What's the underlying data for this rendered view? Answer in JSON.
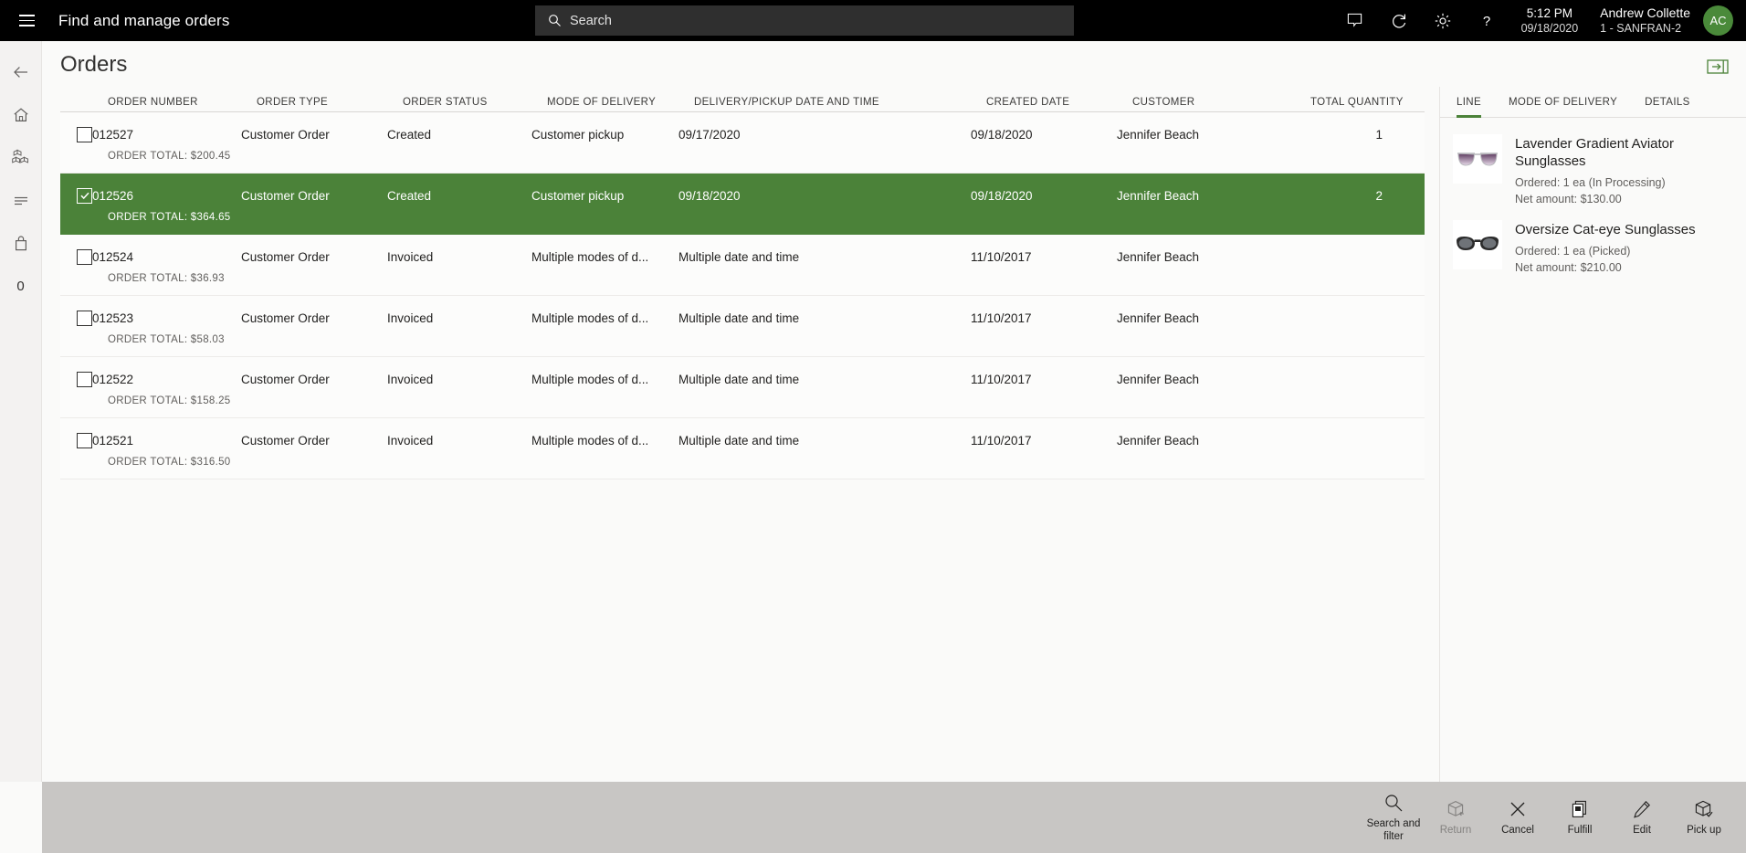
{
  "topbar": {
    "menu_icon": "hamburger-icon",
    "app_title": "Find and manage orders",
    "search": {
      "placeholder": "Search",
      "value": "",
      "icon": "search-icon"
    },
    "icons": [
      "comment-icon",
      "refresh-icon",
      "settings-gear-icon",
      "help-question-icon"
    ],
    "time": "5:12 PM",
    "date": "09/18/2020",
    "user_name": "Andrew Collette",
    "user_store": "1 - SANFRAN-2",
    "avatar_initials": "AC",
    "avatar_color": "#4a8a3a"
  },
  "rail": {
    "items": [
      {
        "name": "back-arrow-icon",
        "label": ""
      },
      {
        "name": "home-icon",
        "label": ""
      },
      {
        "name": "products-cubes-icon",
        "label": ""
      },
      {
        "name": "list-lines-icon",
        "label": ""
      },
      {
        "name": "shopping-bag-icon",
        "label": ""
      }
    ],
    "cart_count": "0"
  },
  "page": {
    "title": "Orders",
    "panel_toggle_icon": "expand-panel-icon",
    "accent_color": "#4b8239"
  },
  "grid": {
    "columns": [
      "ORDER NUMBER",
      "ORDER TYPE",
      "ORDER STATUS",
      "MODE OF DELIVERY",
      "DELIVERY/PICKUP DATE AND TIME",
      "CREATED DATE",
      "CUSTOMER",
      "TOTAL QUANTITY"
    ],
    "rows": [
      {
        "selected": false,
        "checked": false,
        "order_number": "012527",
        "order_type": "Customer Order",
        "order_status": "Created",
        "mode_of_delivery": "Customer pickup",
        "delivery_datetime": "09/17/2020",
        "created_date": "09/18/2020",
        "customer": "Jennifer Beach",
        "total_quantity": "1",
        "order_total": "ORDER TOTAL: $200.45"
      },
      {
        "selected": true,
        "checked": true,
        "order_number": "012526",
        "order_type": "Customer Order",
        "order_status": "Created",
        "mode_of_delivery": "Customer pickup",
        "delivery_datetime": "09/18/2020",
        "created_date": "09/18/2020",
        "customer": "Jennifer Beach",
        "total_quantity": "2",
        "order_total": "ORDER TOTAL: $364.65"
      },
      {
        "selected": false,
        "checked": false,
        "order_number": "012524",
        "order_type": "Customer Order",
        "order_status": "Invoiced",
        "mode_of_delivery": "Multiple modes of d...",
        "delivery_datetime": "Multiple date and time",
        "created_date": "11/10/2017",
        "customer": "Jennifer Beach",
        "total_quantity": "",
        "order_total": "ORDER TOTAL: $36.93"
      },
      {
        "selected": false,
        "checked": false,
        "order_number": "012523",
        "order_type": "Customer Order",
        "order_status": "Invoiced",
        "mode_of_delivery": "Multiple modes of d...",
        "delivery_datetime": "Multiple date and time",
        "created_date": "11/10/2017",
        "customer": "Jennifer Beach",
        "total_quantity": "",
        "order_total": "ORDER TOTAL: $58.03"
      },
      {
        "selected": false,
        "checked": false,
        "order_number": "012522",
        "order_type": "Customer Order",
        "order_status": "Invoiced",
        "mode_of_delivery": "Multiple modes of d...",
        "delivery_datetime": "Multiple date and time",
        "created_date": "11/10/2017",
        "customer": "Jennifer Beach",
        "total_quantity": "",
        "order_total": "ORDER TOTAL: $158.25"
      },
      {
        "selected": false,
        "checked": false,
        "order_number": "012521",
        "order_type": "Customer Order",
        "order_status": "Invoiced",
        "mode_of_delivery": "Multiple modes of d...",
        "delivery_datetime": "Multiple date and time",
        "created_date": "11/10/2017",
        "customer": "Jennifer Beach",
        "total_quantity": "",
        "order_total": "ORDER TOTAL: $316.50"
      }
    ]
  },
  "sidepanel": {
    "tabs": [
      {
        "label": "LINE",
        "active": true
      },
      {
        "label": "MODE OF DELIVERY",
        "active": false
      },
      {
        "label": "DETAILS",
        "active": false
      }
    ],
    "lines": [
      {
        "title": "Lavender Gradient Aviator Sunglasses",
        "ordered": "Ordered: 1 ea (In Processing)",
        "net_amount": "Net amount: $130.00",
        "thumb": "aviator-sunglasses-thumbnail"
      },
      {
        "title": "Oversize Cat-eye Sunglasses",
        "ordered": "Ordered: 1 ea (Picked)",
        "net_amount": "Net amount: $210.00",
        "thumb": "cateye-sunglasses-thumbnail"
      }
    ]
  },
  "commandbar": {
    "buttons": [
      {
        "label": "Search and filter",
        "icon": "search-icon",
        "disabled": false
      },
      {
        "label": "Return",
        "icon": "return-box-icon",
        "disabled": true
      },
      {
        "label": "Cancel",
        "icon": "close-x-icon",
        "disabled": false
      },
      {
        "label": "Fulfill",
        "icon": "fulfill-document-icon",
        "disabled": false
      },
      {
        "label": "Edit",
        "icon": "pencil-edit-icon",
        "disabled": false
      },
      {
        "label": "Pick up",
        "icon": "pickup-box-check-icon",
        "disabled": false
      }
    ]
  }
}
